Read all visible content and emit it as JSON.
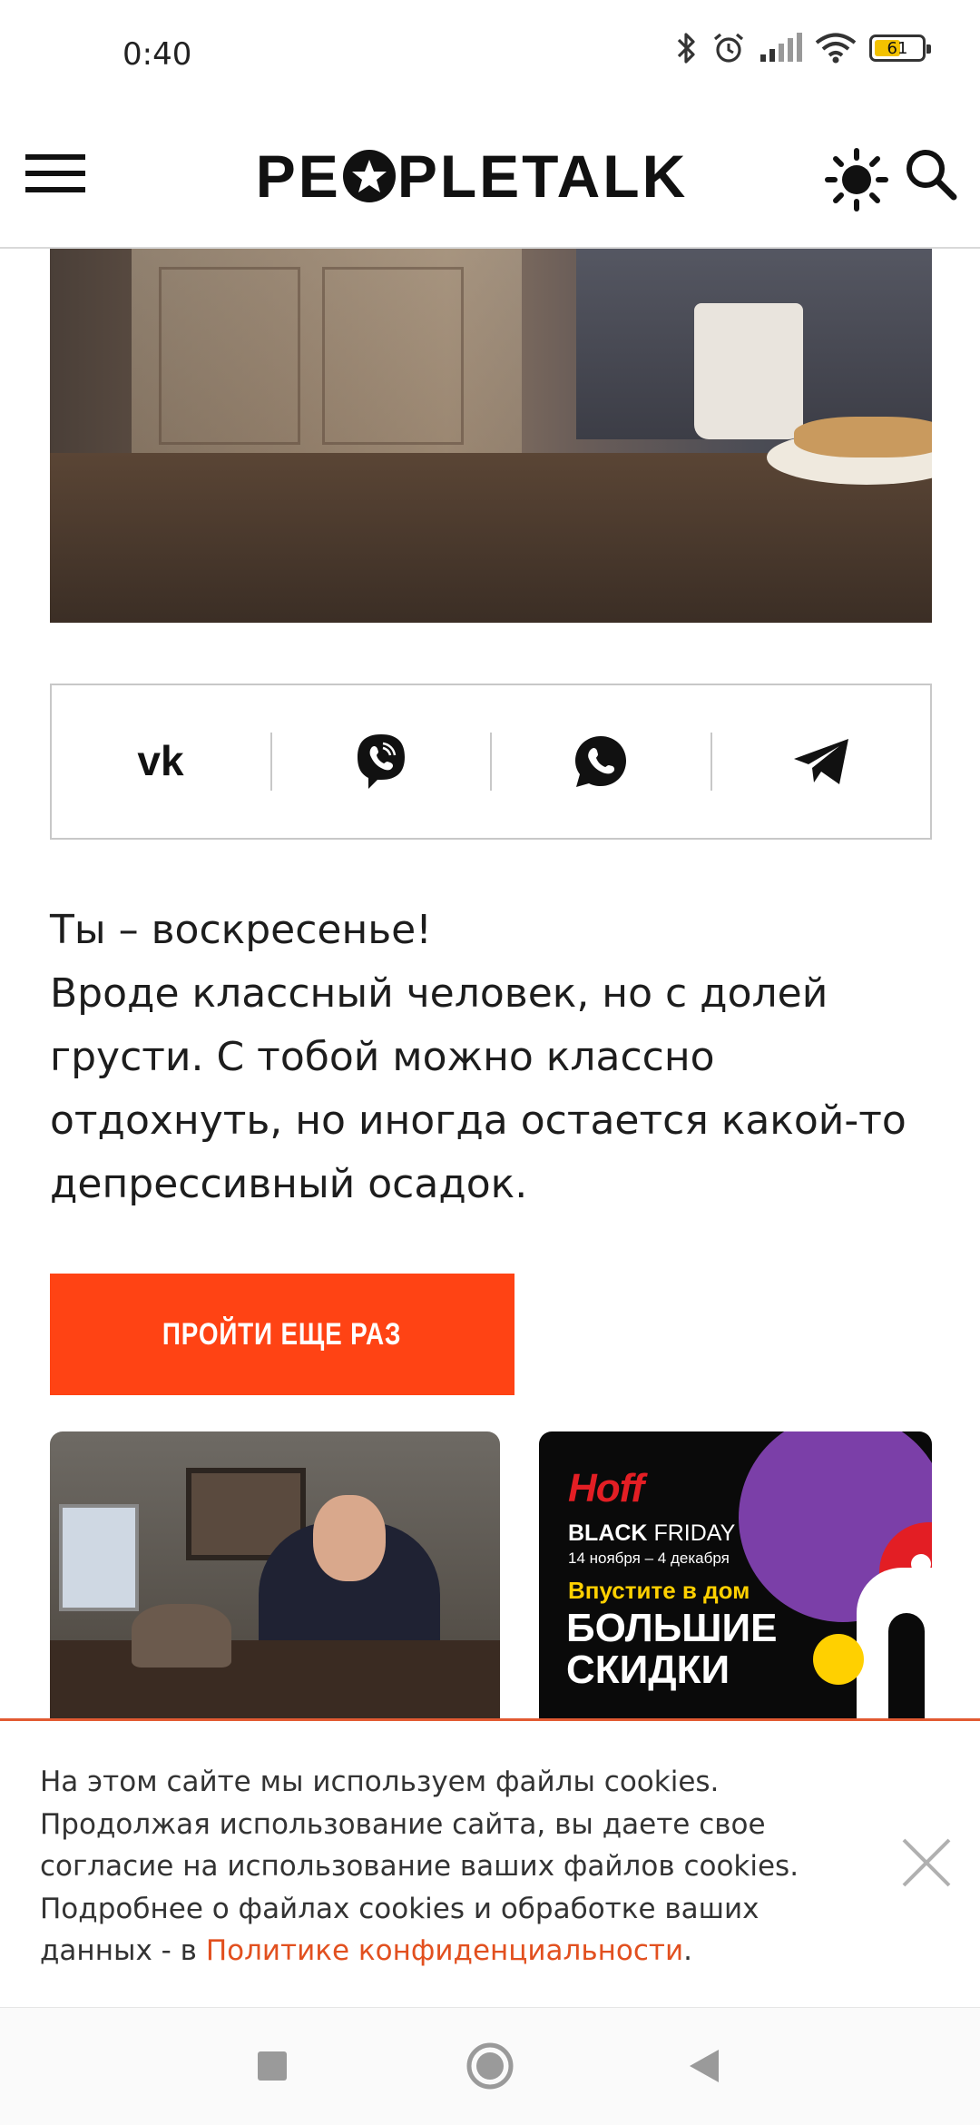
{
  "status_bar": {
    "time": "0:40",
    "battery_level": "61",
    "icons": [
      "bluetooth-icon",
      "alarm-icon",
      "signal-icon",
      "wifi-icon",
      "battery-icon"
    ]
  },
  "header": {
    "logo_left": "PE",
    "logo_right": "PLETALK",
    "icons": [
      "menu-icon",
      "theme-icon",
      "search-icon"
    ]
  },
  "share": {
    "items": [
      "vk-icon",
      "viber-icon",
      "whatsapp-icon",
      "telegram-icon"
    ]
  },
  "result": {
    "title": "Ты – воскресенье!",
    "description": "Вроде классный человек, но с долей грусти. С тобой можно классно отдохнуть, но иногда остается какой-то депрессивный осадок."
  },
  "retry_button": "ПРОЙТИ ЕЩЕ РАЗ",
  "ad_card": {
    "brand": "Hoff",
    "title_bold": "BLACK",
    "title_rest": " FRIDAY",
    "dates": "14 ноября – 4 декабря",
    "subtitle": "Впустите в дом",
    "big_line_1": "БОЛЬШИЕ",
    "big_line_2": "СКИДКИ"
  },
  "cookie": {
    "text": "На этом сайте мы используем файлы cookies. Продолжая использование сайта, вы даете свое согласие на использование ваших файлов cookies. Подробнее о файлах cookies и обработке ваших данных - в ",
    "link_text": "Политике конфиденциальности",
    "end": "."
  },
  "nav_bar": {
    "buttons": [
      "recents-button",
      "home-button",
      "back-button"
    ]
  },
  "colors": {
    "accent": "#ff4314",
    "link": "#e2501f",
    "battery": "#f3c200"
  }
}
